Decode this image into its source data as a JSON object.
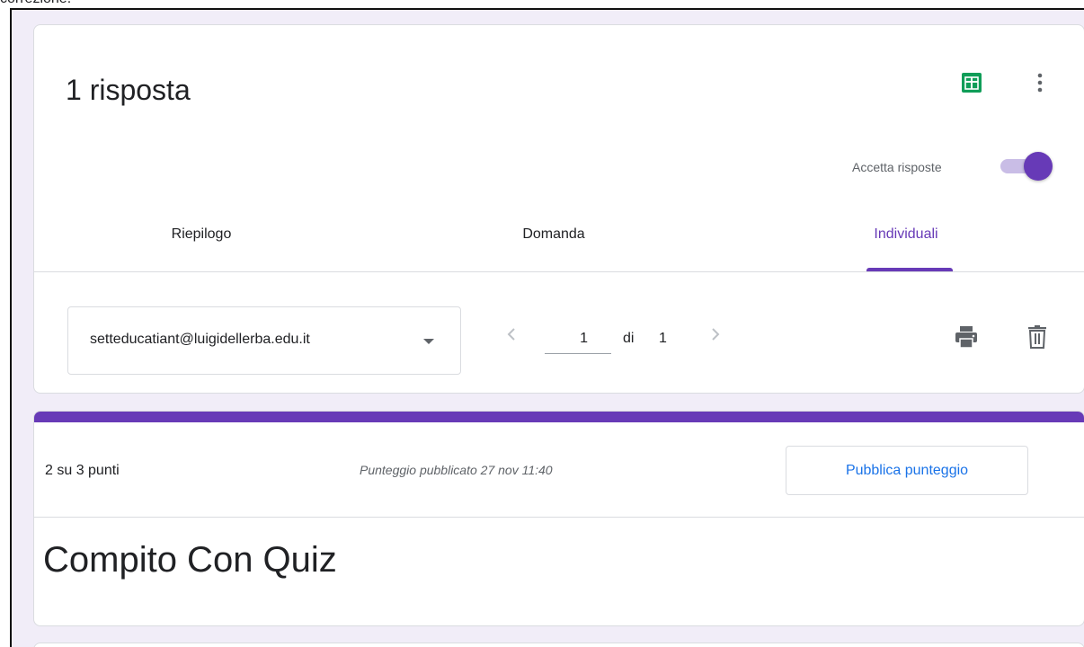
{
  "top_clipped_text": "correzione.",
  "header": {
    "title": "1 risposta",
    "accept_label": "Accetta risposte",
    "accept_on": true,
    "sheets_icon": "google-sheets-icon",
    "more_icon": "more-vert-icon"
  },
  "tabs": [
    {
      "label": "Riepilogo",
      "active": false
    },
    {
      "label": "Domanda",
      "active": false
    },
    {
      "label": "Individuali",
      "active": true
    }
  ],
  "responder": {
    "selected_email": "setteducatiant@luigidellerba.edu.it",
    "current_page": "1",
    "of_label": "di",
    "total_pages": "1"
  },
  "actions": {
    "print_icon": "print-icon",
    "delete_icon": "trash-icon"
  },
  "score_card": {
    "score": "2 su 3 punti",
    "published": "Punteggio pubblicato 27 nov 11:40",
    "publish_button": "Pubblica punteggio",
    "quiz_title": "Compito Con Quiz"
  },
  "colors": {
    "accent": "#673ab7",
    "link_blue": "#1a73e8",
    "background": "#f1edf8",
    "sheets_green": "#0f9d58"
  }
}
